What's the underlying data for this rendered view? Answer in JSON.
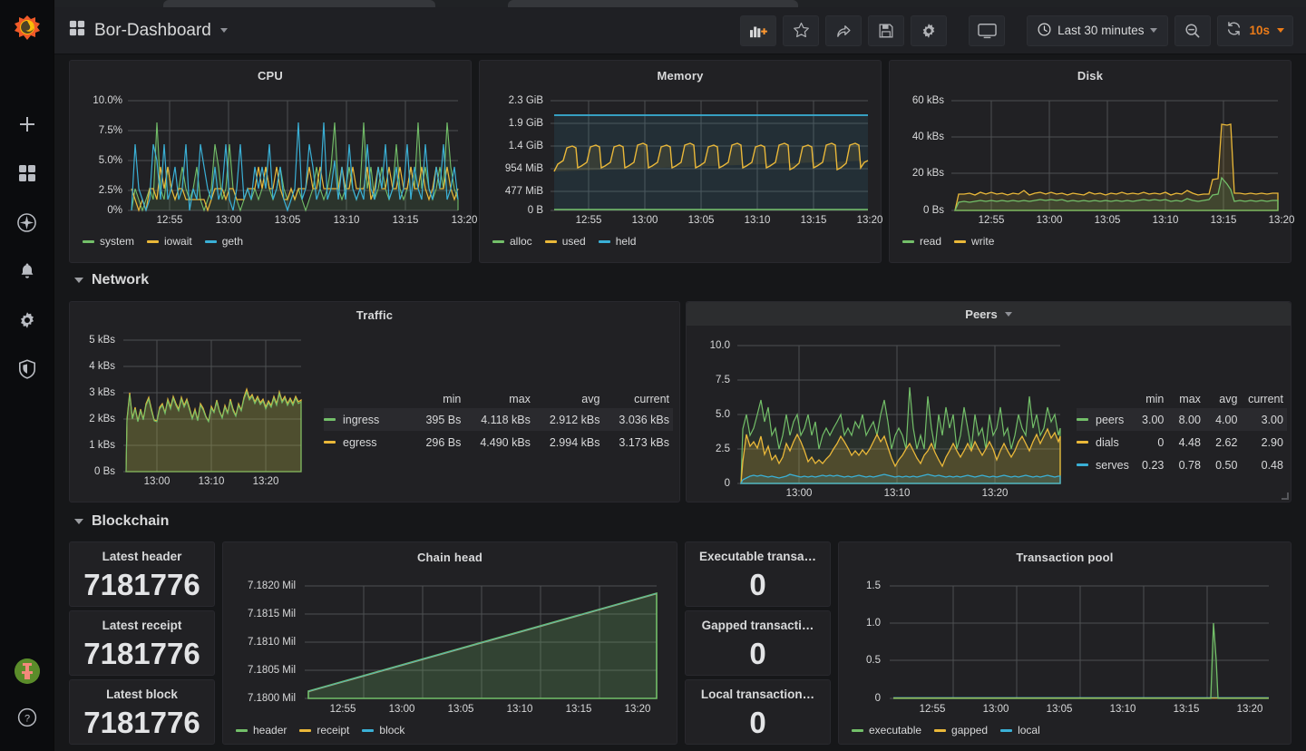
{
  "app": {
    "brand_icon": "grafana-logo-icon",
    "nav_items": [
      {
        "name": "create-add",
        "icon": "plus-icon"
      },
      {
        "name": "dashboards",
        "icon": "apps-grid-icon"
      },
      {
        "name": "explore",
        "icon": "compass-icon"
      },
      {
        "name": "alerting",
        "icon": "bell-icon"
      },
      {
        "name": "configuration",
        "icon": "gear-icon"
      },
      {
        "name": "server-admin",
        "icon": "shield-icon"
      }
    ],
    "avatar_label": "user-avatar",
    "help_label": "help-icon"
  },
  "topbar": {
    "dashboard_title": "Bor-Dashboard",
    "dashboard_icon": "apps-grid-icon",
    "buttons": [
      {
        "name": "add-panel-button",
        "icon": "add-panel-icon"
      },
      {
        "name": "mark-favorite-button",
        "icon": "star-icon"
      },
      {
        "name": "share-dashboard-button",
        "icon": "share-icon"
      },
      {
        "name": "save-dashboard-button",
        "icon": "save-disk-icon"
      },
      {
        "name": "dashboard-settings-button",
        "icon": "gear-icon"
      },
      {
        "name": "tv-mode-button",
        "icon": "monitor-icon"
      }
    ],
    "time_range": "Last 30 minutes",
    "time_range_icon": "clock-icon",
    "zoom_out_icon": "zoom-out-magnifier-icon",
    "refresh_icon": "refresh-icon",
    "refresh_interval": "10s",
    "accent_color": "#eb7b18"
  },
  "colors": {
    "green": "#73bf69",
    "yellow": "#eab839",
    "cyan": "#3ab0d6",
    "table_header": "#33b5e5",
    "panel_bg": "#212124",
    "page_bg": "#161719"
  },
  "rows": [
    {
      "name": "network-row",
      "label": "Network"
    },
    {
      "name": "blockchain-row",
      "label": "Blockchain"
    }
  ],
  "panels": {
    "cpu": {
      "title": "CPU"
    },
    "memory": {
      "title": "Memory"
    },
    "disk": {
      "title": "Disk"
    },
    "traffic": {
      "title": "Traffic"
    },
    "peers": {
      "title": "Peers"
    },
    "chain_head": {
      "title": "Chain head"
    },
    "tx_pool": {
      "title": "Transaction pool"
    },
    "latest_header": {
      "title": "Latest header",
      "value": "7181776"
    },
    "latest_receipt": {
      "title": "Latest receipt",
      "value": "7181776"
    },
    "latest_block": {
      "title": "Latest block",
      "value": "7181776"
    },
    "executable_tx": {
      "title": "Executable transa…",
      "value": "0"
    },
    "gapped_tx": {
      "title": "Gapped transacti…",
      "value": "0"
    },
    "local_tx": {
      "title": "Local transaction…",
      "value": "0"
    }
  },
  "legend_table_headers": [
    "min",
    "max",
    "avg",
    "current"
  ],
  "traffic_table": [
    {
      "name": "ingress",
      "color": "#73bf69",
      "min": "395 Bs",
      "max": "4.118 kBs",
      "avg": "2.912 kBs",
      "current": "3.036 kBs",
      "highlight": true
    },
    {
      "name": "egress",
      "color": "#eab839",
      "min": "296 Bs",
      "max": "4.490 kBs",
      "avg": "2.994 kBs",
      "current": "3.173 kBs",
      "highlight": false
    }
  ],
  "peers_table": [
    {
      "name": "peers",
      "color": "#73bf69",
      "min": "3.00",
      "max": "8.00",
      "avg": "4.00",
      "current": "3.00",
      "highlight": true
    },
    {
      "name": "dials",
      "color": "#eab839",
      "min": "0",
      "max": "4.48",
      "avg": "2.62",
      "current": "2.90",
      "highlight": false
    },
    {
      "name": "serves",
      "color": "#3ab0d6",
      "min": "0.23",
      "max": "0.78",
      "avg": "0.50",
      "current": "0.48",
      "highlight": false
    }
  ],
  "chart_data": [
    {
      "panel": "cpu",
      "type": "line",
      "title": "CPU",
      "ylabel": "",
      "xlabel": "",
      "yticks": [
        "0%",
        "2.5%",
        "5.0%",
        "7.5%",
        "10.0%"
      ],
      "ylim": [
        0,
        10
      ],
      "grid": true,
      "xticks": [
        "12:55",
        "13:00",
        "13:05",
        "13:10",
        "13:15",
        "13:20"
      ],
      "legend_position": "bottom",
      "series": [
        {
          "name": "system",
          "color": "#73bf69",
          "values": [
            0,
            2,
            1,
            0,
            1,
            2,
            1,
            8,
            2,
            1,
            3,
            2,
            1,
            2,
            3,
            2,
            1,
            2,
            3,
            1,
            0,
            1,
            2,
            5,
            3,
            1,
            2,
            5,
            2,
            1,
            0,
            1,
            2,
            1,
            2,
            1,
            2,
            3,
            2,
            1,
            2,
            3,
            2,
            1,
            2,
            1,
            2,
            1,
            0,
            1,
            2,
            3,
            2,
            1,
            2,
            3,
            6,
            2,
            1,
            2,
            3,
            2,
            1,
            2,
            6,
            2,
            3
          ]
        },
        {
          "name": "iowait",
          "color": "#eab839",
          "values": [
            2,
            1,
            0,
            1,
            0,
            2,
            2,
            1,
            3,
            2,
            3,
            2,
            1,
            2,
            2,
            1,
            1,
            1,
            1,
            1,
            1,
            0,
            1,
            2,
            2,
            2,
            1,
            2,
            2,
            1,
            1,
            1,
            2,
            2,
            2,
            3,
            2,
            3,
            2,
            2,
            3,
            2,
            1,
            1,
            2,
            1,
            2,
            2,
            2,
            3,
            2,
            2,
            3,
            2,
            2,
            2,
            2,
            2,
            3,
            2,
            2,
            3,
            2,
            2,
            2,
            3,
            1
          ]
        },
        {
          "name": "geth",
          "color": "#3ab0d6",
          "values": [
            0,
            4,
            2,
            1,
            0,
            1,
            5,
            4,
            1,
            4,
            1,
            2,
            3,
            1,
            2,
            4,
            0,
            2,
            1,
            4,
            3,
            2,
            1,
            3,
            1,
            2,
            4,
            1,
            0,
            2,
            4,
            1,
            2,
            1,
            3,
            2,
            3,
            2,
            4,
            1,
            2,
            3,
            1,
            0,
            1,
            2,
            5,
            1,
            2,
            4,
            3,
            1,
            2,
            5,
            1,
            2,
            4,
            1,
            3,
            1,
            5,
            2,
            1,
            2,
            1,
            4,
            1
          ]
        }
      ]
    },
    {
      "panel": "memory",
      "type": "area",
      "title": "Memory",
      "yticks": [
        "0 B",
        "477 MiB",
        "954 MiB",
        "1.4 GiB",
        "1.9 GiB",
        "2.3 GiB"
      ],
      "ylim": [
        0,
        2.3
      ],
      "grid": true,
      "xticks": [
        "12:55",
        "13:00",
        "13:05",
        "13:10",
        "13:15",
        "13:20"
      ],
      "legend_position": "bottom",
      "series": [
        {
          "name": "alloc",
          "color": "#73bf69",
          "description": "flat near 0 B"
        },
        {
          "name": "used",
          "color": "#eab839",
          "description": "sawtooth oscillating between ~1.0 GiB and ~1.5 GiB"
        },
        {
          "name": "held",
          "color": "#3ab0d6",
          "description": "flat near 2.05 GiB"
        }
      ]
    },
    {
      "panel": "disk",
      "type": "area",
      "title": "Disk",
      "yticks": [
        "0 Bs",
        "20 kBs",
        "40 kBs",
        "60 kBs"
      ],
      "ylim": [
        0,
        60
      ],
      "grid": true,
      "xticks": [
        "12:55",
        "13:00",
        "13:05",
        "13:10",
        "13:15",
        "13:20"
      ],
      "legend_position": "bottom",
      "series": [
        {
          "name": "read",
          "color": "#73bf69",
          "description": "~4-6 kBs baseline, spike to ~18 kBs near 13:21"
        },
        {
          "name": "write",
          "color": "#eab839",
          "description": "~9-11 kBs baseline, spike to ~50 kBs near 13:21"
        }
      ]
    },
    {
      "panel": "traffic",
      "type": "area",
      "title": "Traffic",
      "yticks": [
        "0 Bs",
        "1 kBs",
        "2 kBs",
        "3 kBs",
        "4 kBs",
        "5 kBs"
      ],
      "ylim": [
        0,
        5
      ],
      "grid": true,
      "xticks": [
        "13:00",
        "13:10",
        "13:20"
      ],
      "legend_position": "right-table",
      "series": [
        {
          "name": "ingress",
          "color": "#73bf69",
          "description": "noisy 2-4 kBs"
        },
        {
          "name": "egress",
          "color": "#eab839",
          "description": "noisy 2-4.5 kBs, peak ~4.49 kBs"
        }
      ]
    },
    {
      "panel": "peers",
      "type": "area",
      "title": "Peers",
      "yticks": [
        "0",
        "2.5",
        "5.0",
        "7.5",
        "10.0"
      ],
      "ylim": [
        0,
        10
      ],
      "grid": true,
      "xticks": [
        "13:00",
        "13:10",
        "13:20"
      ],
      "legend_position": "right-table",
      "series": [
        {
          "name": "peers",
          "color": "#73bf69",
          "description": "spiky 3-8"
        },
        {
          "name": "dials",
          "color": "#eab839",
          "description": "spiky 0-4.5, avg 2.62"
        },
        {
          "name": "serves",
          "color": "#3ab0d6",
          "description": "flat ~0.5"
        }
      ]
    },
    {
      "panel": "chain_head",
      "type": "area",
      "title": "Chain head",
      "yticks": [
        "7.1800 Mil",
        "7.1805 Mil",
        "7.1810 Mil",
        "7.1815 Mil",
        "7.1820 Mil"
      ],
      "ylim": [
        7.18,
        7.182
      ],
      "grid": true,
      "xticks": [
        "12:55",
        "13:00",
        "13:05",
        "13:10",
        "13:15",
        "13:20"
      ],
      "legend_position": "bottom",
      "series": [
        {
          "name": "header",
          "color": "#73bf69",
          "description": "linear rise 7.18013 -> 7.18177 Mil"
        },
        {
          "name": "receipt",
          "color": "#eab839",
          "description": "overlaps header"
        },
        {
          "name": "block",
          "color": "#3ab0d6",
          "description": "overlaps header"
        }
      ]
    },
    {
      "panel": "tx_pool",
      "type": "line",
      "title": "Transaction pool",
      "yticks": [
        "0",
        "0.5",
        "1.0",
        "1.5"
      ],
      "ylim": [
        0,
        1.5
      ],
      "grid": true,
      "xticks": [
        "12:55",
        "13:00",
        "13:05",
        "13:10",
        "13:15",
        "13:20"
      ],
      "legend_position": "bottom",
      "series": [
        {
          "name": "executable",
          "color": "#73bf69",
          "description": "0 everywhere, single spike to 1.0 near 13:21"
        },
        {
          "name": "gapped",
          "color": "#eab839",
          "description": "flat 0"
        },
        {
          "name": "local",
          "color": "#3ab0d6",
          "description": "flat 0"
        }
      ]
    }
  ]
}
